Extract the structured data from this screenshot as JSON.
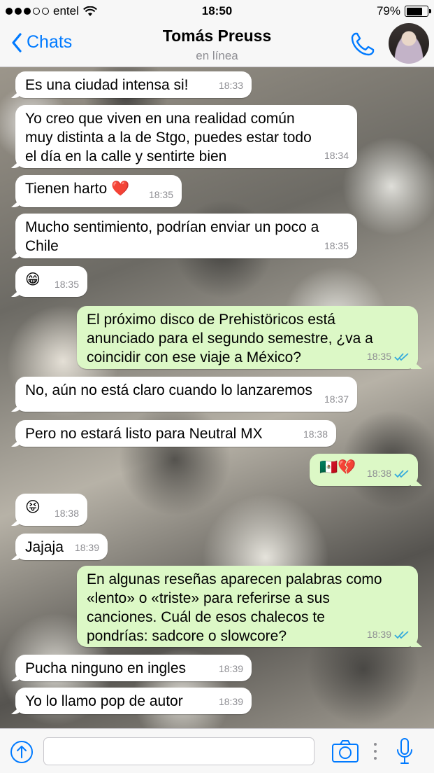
{
  "status_bar": {
    "carrier": "entel",
    "time": "18:50",
    "battery_text": "79%",
    "battery_level": 0.79,
    "signal_bars_filled": 3,
    "signal_bars_total": 5
  },
  "header": {
    "back_label": "Chats",
    "contact_name": "Tomás Preuss",
    "presence": "en línea"
  },
  "messages": [
    {
      "text": "Es una ciudad intensa si!",
      "time": "18:33",
      "direction": "in"
    },
    {
      "text": "Yo creo que viven en una realidad común\nmuy distinta a la de Stgo, puedes estar todo\nel día en la calle y sentirte bien",
      "time": "18:34",
      "direction": "in"
    },
    {
      "text": "Tienen harto ❤️",
      "time": "18:35",
      "direction": "in"
    },
    {
      "text": "Mucho sentimiento, podrían enviar un poco a\nChile",
      "time": "18:35",
      "direction": "in"
    },
    {
      "text": "😁",
      "time": "18:35",
      "direction": "in"
    },
    {
      "text": "El próximo disco de Prehistöricos está\nanunciado para el segundo semestre, ¿va a\ncoincidir con ese viaje a México?",
      "time": "18:35",
      "direction": "out",
      "status": "read"
    },
    {
      "text": "No, aún no está claro cuando lo lanzaremos",
      "time": "18:37",
      "direction": "in"
    },
    {
      "text": "Pero no estará listo para Neutral MX",
      "time": "18:38",
      "direction": "in"
    },
    {
      "text": "🇲🇽💔",
      "time": "18:38",
      "direction": "out",
      "status": "read"
    },
    {
      "text": "😝",
      "time": "18:38",
      "direction": "in"
    },
    {
      "text": "Jajaja",
      "time": "18:39",
      "direction": "in"
    },
    {
      "text": "En algunas reseñas aparecen palabras como\n«lento» o «triste» para referirse a sus\ncanciones. Cuál de esos chalecos te\npondrías: sadcore o slowcore?",
      "time": "18:39",
      "direction": "out",
      "status": "read"
    },
    {
      "text": "Pucha ninguno en ingles",
      "time": "18:39",
      "direction": "in"
    },
    {
      "text": "Yo lo llamo pop de autor",
      "time": "18:39",
      "direction": "in"
    }
  ],
  "composer": {
    "placeholder": "",
    "value": ""
  },
  "icons": {
    "back": "chevron-left-icon",
    "call": "phone-icon",
    "attach": "share-arrow-icon",
    "camera": "camera-icon",
    "mic": "microphone-icon",
    "read_receipt": "double-check-icon"
  },
  "colors": {
    "accent": "#007aff",
    "incoming_bubble": "#ffffff",
    "outgoing_bubble": "#dcf8c6",
    "read_tick": "#34aadc"
  }
}
